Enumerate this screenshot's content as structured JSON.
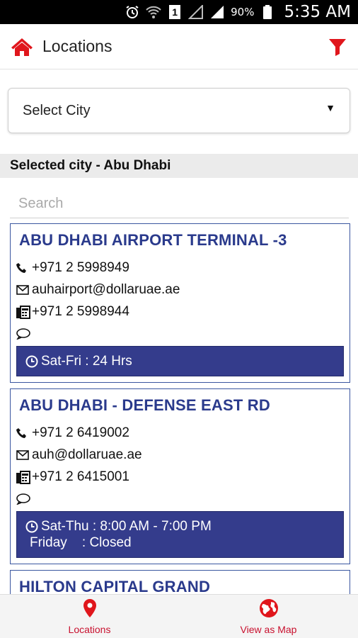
{
  "status_bar": {
    "sim_label": "1",
    "battery": "90%",
    "time": "5:35 AM"
  },
  "app_bar": {
    "title": "Locations",
    "home_icon": "home-icon",
    "filter_icon": "filter-icon"
  },
  "city_select": {
    "label": "Select City",
    "caret": "▼"
  },
  "selected_city": "Selected city - Abu Dhabi",
  "search": {
    "placeholder": "Search",
    "value": ""
  },
  "locations": [
    {
      "name": "ABU DHABI AIRPORT TERMINAL -3",
      "phone": "+971 2 5998949",
      "email": "auhairport@dollaruae.ae",
      "fax": "+971 2 5998944",
      "comment": "",
      "hours": [
        "Sat-Fri : 24 Hrs"
      ]
    },
    {
      "name": "ABU DHABI - DEFENSE EAST RD",
      "phone": "+971 2 6419002",
      "email": "auh@dollaruae.ae",
      "fax": "+971 2 6415001",
      "comment": "",
      "hours": [
        "Sat-Thu : 8:00 AM - 7:00 PM",
        "Friday    : Closed"
      ]
    },
    {
      "name": "HILTON CAPITAL GRAND"
    }
  ],
  "bottom_nav": {
    "locations_label": "Locations",
    "map_label": "View as Map"
  },
  "colors": {
    "accent_red": "#e0161c",
    "card_title_blue": "#2a3a8c",
    "hours_bg": "#343c8c"
  }
}
